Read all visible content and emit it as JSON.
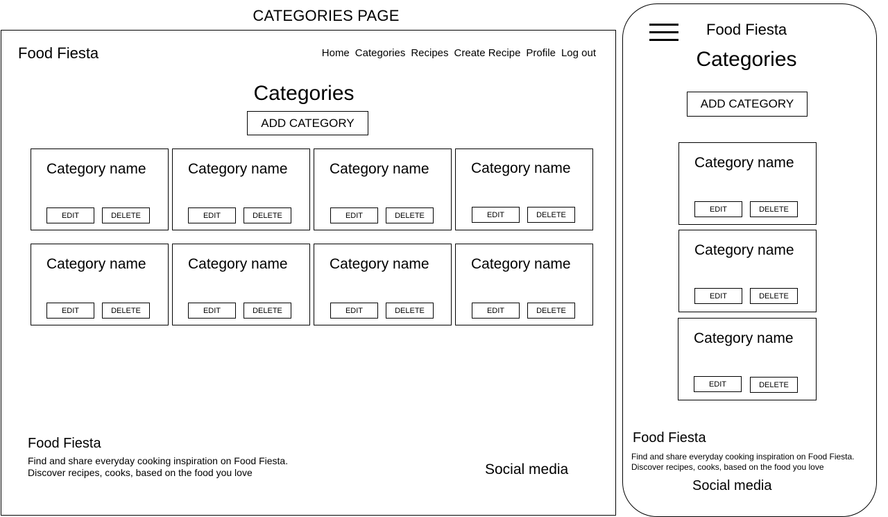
{
  "page_title": "CATEGORIES PAGE",
  "desktop": {
    "brand": "Food Fiesta",
    "nav": [
      "Home",
      "Categories",
      "Recipes",
      "Create Recipe",
      "Profile",
      "Log out"
    ],
    "heading": "Categories",
    "add_button": "ADD CATEGORY",
    "cards": [
      {
        "name": "Category name",
        "edit": "EDIT",
        "delete": "DELETE"
      },
      {
        "name": "Category name",
        "edit": "EDIT",
        "delete": "DELETE"
      },
      {
        "name": "Category name",
        "edit": "EDIT",
        "delete": "DELETE"
      },
      {
        "name": "Category name",
        "edit": "EDIT",
        "delete": "DELETE"
      },
      {
        "name": "Category name",
        "edit": "EDIT",
        "delete": "DELETE"
      },
      {
        "name": "Category name",
        "edit": "EDIT",
        "delete": "DELETE"
      },
      {
        "name": "Category name",
        "edit": "EDIT",
        "delete": "DELETE"
      },
      {
        "name": "Category name",
        "edit": "EDIT",
        "delete": "DELETE"
      }
    ],
    "footer": {
      "brand": "Food Fiesta",
      "line1": "Find and share everyday cooking inspiration on Food Fiesta.",
      "line2": "Discover recipes, cooks, based on the food you love",
      "social": "Social media"
    }
  },
  "mobile": {
    "menu_icon": "hamburger-icon",
    "brand": "Food Fiesta",
    "heading": "Categories",
    "add_button": "ADD CATEGORY",
    "cards": [
      {
        "name": "Category name",
        "edit": "EDIT",
        "delete": "DELETE"
      },
      {
        "name": "Category name",
        "edit": "EDIT",
        "delete": "DELETE"
      },
      {
        "name": "Category name",
        "edit": "EDIT",
        "delete": "DELETE"
      }
    ],
    "footer": {
      "brand": "Food Fiesta",
      "line1": "Find and share everyday cooking inspiration on Food Fiesta.",
      "line2": "Discover recipes, cooks, based on the food you love",
      "social": "Social media"
    }
  }
}
